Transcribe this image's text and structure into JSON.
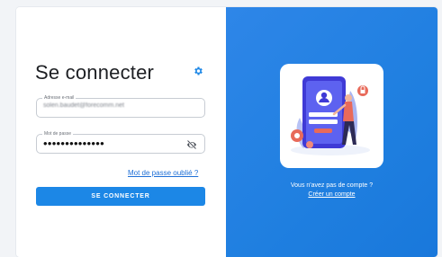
{
  "login": {
    "title": "Se connecter",
    "settings_icon": "gear-icon",
    "email": {
      "label": "Adresse e-mail",
      "value": "solen.baudet@forecomm.net"
    },
    "password": {
      "label": "Mot de passe",
      "value": "••••••••••••••",
      "toggle_icon": "eye-off-icon"
    },
    "forgot_link": "Mot de passe oublié ?",
    "submit_label": "SE CONNECTER"
  },
  "signup": {
    "prompt": "Vous n'avez pas de compte ?",
    "link": "Créer un compte",
    "illustration": "mobile-login-illustration"
  },
  "colors": {
    "accent": "#1c87e6",
    "panel": "#2582e6",
    "link": "#1e6fd6"
  }
}
